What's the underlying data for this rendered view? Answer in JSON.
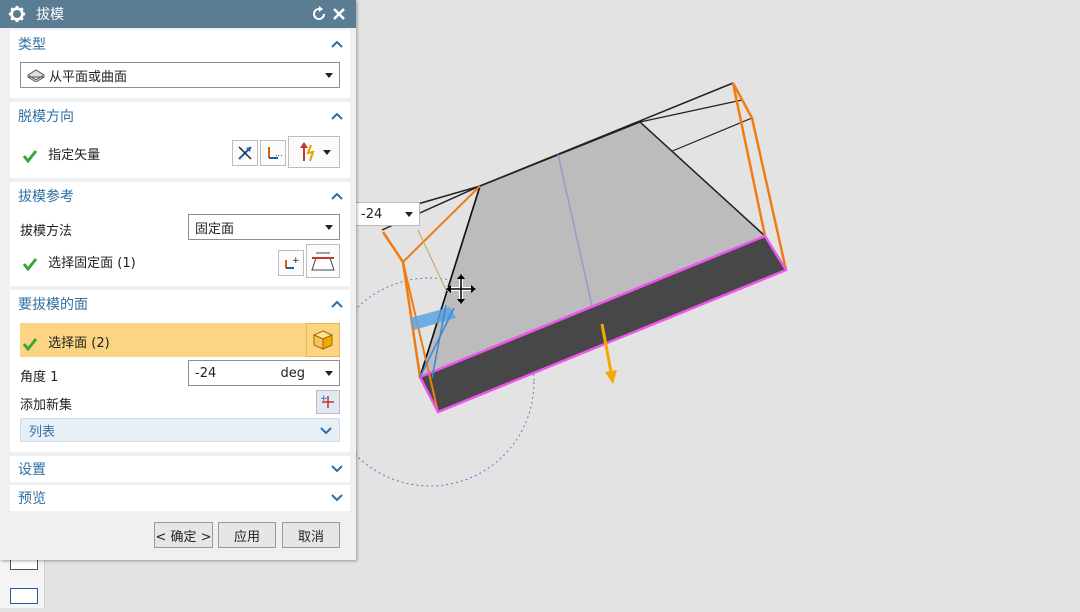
{
  "dialog": {
    "title": "拔模",
    "sections": {
      "type": {
        "header": "类型",
        "dropdown_value": "从平面或曲面"
      },
      "draw_direction": {
        "header": "脱模方向",
        "specify_vector_label": "指定矢量"
      },
      "draft_reference": {
        "header": "拔模参考",
        "method_label": "拔模方法",
        "method_value": "固定面",
        "select_stationary_label": "选择固定面 (1)"
      },
      "faces_to_draft": {
        "header": "要拔模的面",
        "select_face_label": "选择面 (2)",
        "angle_label": "角度 1",
        "angle_value": "-24",
        "angle_unit": "deg",
        "add_new_set_label": "添加新集",
        "list_label": "列表"
      },
      "settings": {
        "header": "设置"
      },
      "preview": {
        "header": "预览"
      }
    },
    "buttons": {
      "ok": "< 确定 >",
      "apply": "应用",
      "cancel": "取消"
    }
  },
  "viewport": {
    "angle_dropdown_value": "-24"
  },
  "colors": {
    "titlebar": "#5b7d93",
    "section_header_text": "#2d6fa3",
    "active_selection": "#fbd581",
    "check": "#3aa53a",
    "bounding_box": "#f07c14",
    "selected_edge": "#ee55ee",
    "direction_arrow": "#f2a900"
  }
}
